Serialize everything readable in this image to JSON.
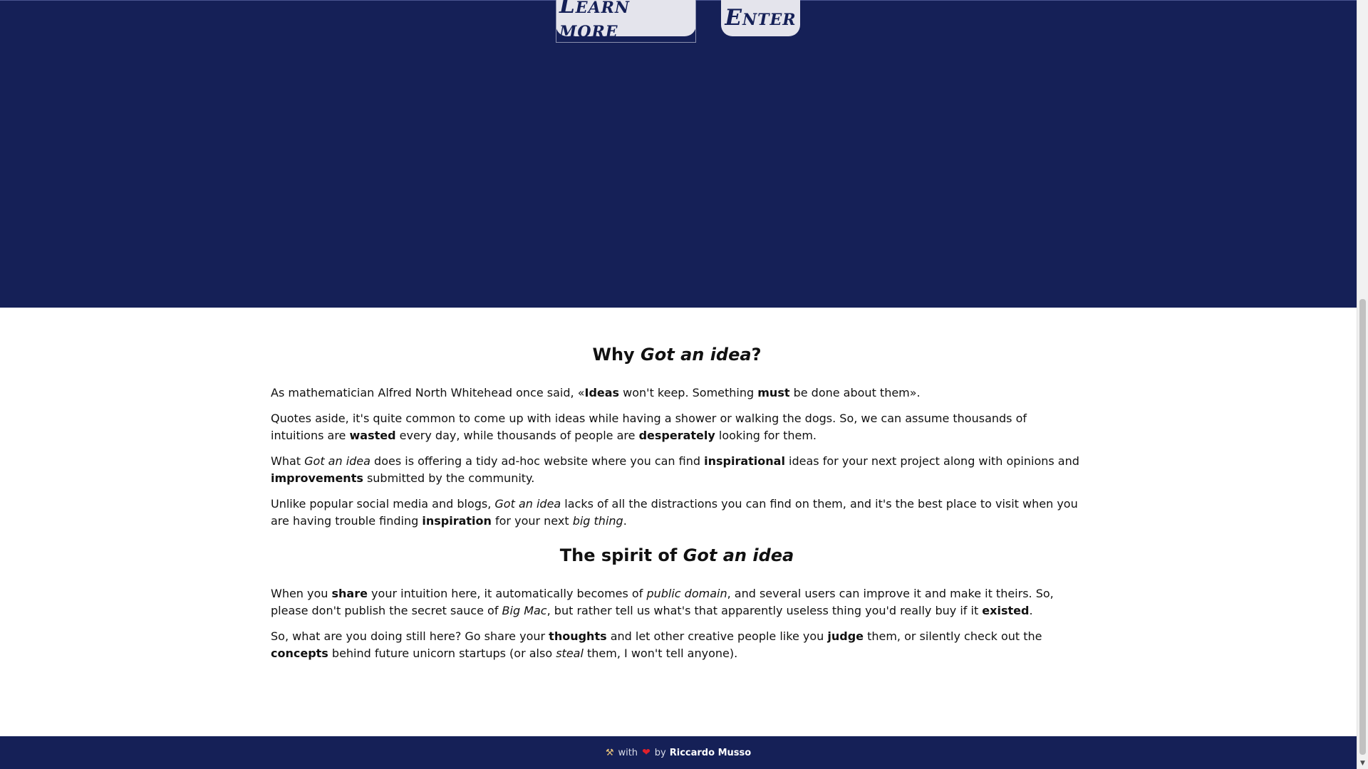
{
  "hero": {
    "learn_more_label": "Learn more",
    "enter_label": "Enter",
    "background_color": "#152057"
  },
  "about": {
    "heading_prefix": "Why ",
    "heading_em": "Got an idea",
    "heading_suffix": "?",
    "p1": {
      "t1": "As mathematician Alfred North Whitehead once said, «",
      "b1": "Ideas",
      "t2": " won't keep. Something ",
      "b2": "must",
      "t3": " be done about them»."
    },
    "p2": {
      "t1": "Quotes aside, it's quite common to come up with ideas while having a shower or walking the dogs. So, we can assume thousands of intuitions are ",
      "b1": "wasted",
      "t2": " every day, while thousands of people are ",
      "b2": "desperately",
      "t3": " looking for them."
    },
    "p3": {
      "t1": "What ",
      "em1": "Got an idea",
      "t2": " does is offering a tidy ad-hoc website where you can find ",
      "b1": "inspirational",
      "t3": " ideas for your next project along with opinions and ",
      "b2": "improvements",
      "t4": " submitted by the community."
    },
    "p4": {
      "t1": "Unlike popular social media and blogs, ",
      "em1": "Got an idea",
      "t2": " lacks of all the distractions you can find on them, and it's the best place to visit when you are having trouble finding ",
      "b1": "inspiration",
      "t3": " for your next ",
      "em2": "big thing",
      "t4": "."
    }
  },
  "spirit": {
    "heading_prefix": "The spirit of ",
    "heading_em": "Got an idea",
    "p1": {
      "t1": "When you ",
      "b1": "share",
      "t2": " your intuition here, it automatically becomes of ",
      "em1": "public domain",
      "t3": ", and several users can improve it and make it theirs. So, please don't publish the secret sauce of ",
      "em2": "Big Mac",
      "t4": ", but rather tell us what's that apparently useless thing you'd really buy if it ",
      "b2": "existed",
      "t5": "."
    },
    "p2": {
      "t1": "So, what are you doing still here? Go share your ",
      "b1": "thoughts",
      "t2": " and let other creative people like you ",
      "b2": "judge",
      "t3": " them, or silently check out the ",
      "b3": "concepts",
      "t4": " behind future unicorn startups (or also ",
      "em1": "steal",
      "t5": " them, I won't tell anyone)."
    }
  },
  "footer": {
    "tools_icon": "⚒",
    "with_text": "with",
    "heart_icon": "❤",
    "by_text": "by",
    "author": "Riccardo Musso",
    "heart_color": "#e0202a"
  },
  "scrollbar": {
    "down_arrow": "▼"
  }
}
